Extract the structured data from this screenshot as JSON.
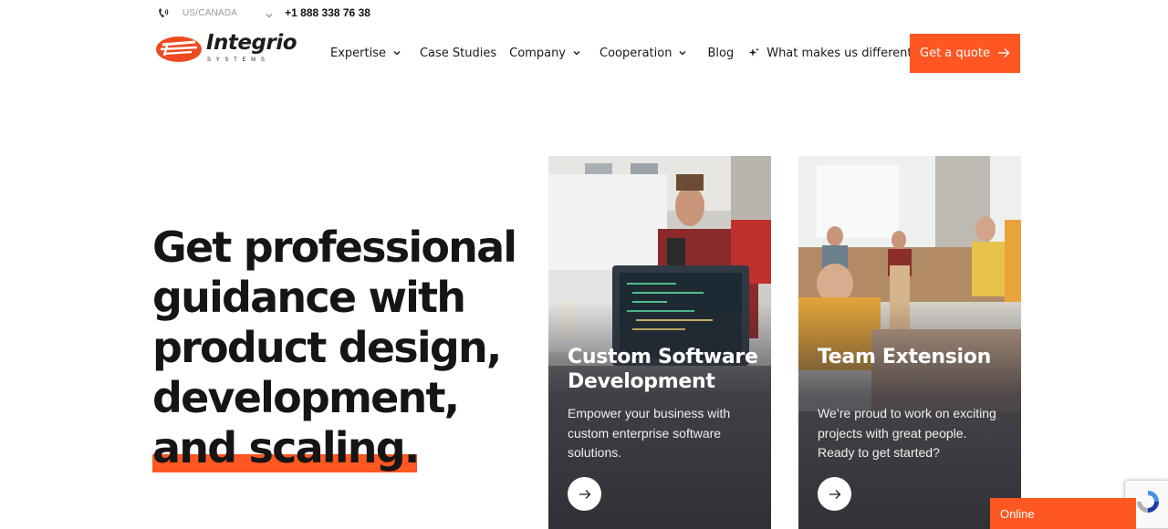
{
  "topbar": {
    "region": "US/CANADA",
    "phone": "+1 888 338 76 38"
  },
  "logo": {
    "name": "Integrio",
    "subtitle": "SYSTEMS"
  },
  "nav": {
    "items": [
      {
        "label": "Expertise",
        "has_dropdown": true
      },
      {
        "label": "Case Studies",
        "has_dropdown": false
      },
      {
        "label": "Company",
        "has_dropdown": true
      },
      {
        "label": "Cooperation",
        "has_dropdown": true
      },
      {
        "label": "Blog",
        "has_dropdown": false
      },
      {
        "label": "What makes us different",
        "has_dropdown": false
      }
    ],
    "cta": "Get a quote"
  },
  "hero": {
    "lines": [
      "Get professional",
      "guidance with",
      "product design,",
      "development,",
      "and scaling."
    ]
  },
  "cards": [
    {
      "title": "Custom Software Development",
      "description": "Empower your business with custom enterprise software solutions."
    },
    {
      "title": "Team Extension",
      "description": "We’re proud to work on exciting projects with great people. Ready to get started?"
    }
  ],
  "chat": {
    "label": "Online"
  },
  "colors": {
    "accent": "#ff5722",
    "text": "#151515"
  }
}
